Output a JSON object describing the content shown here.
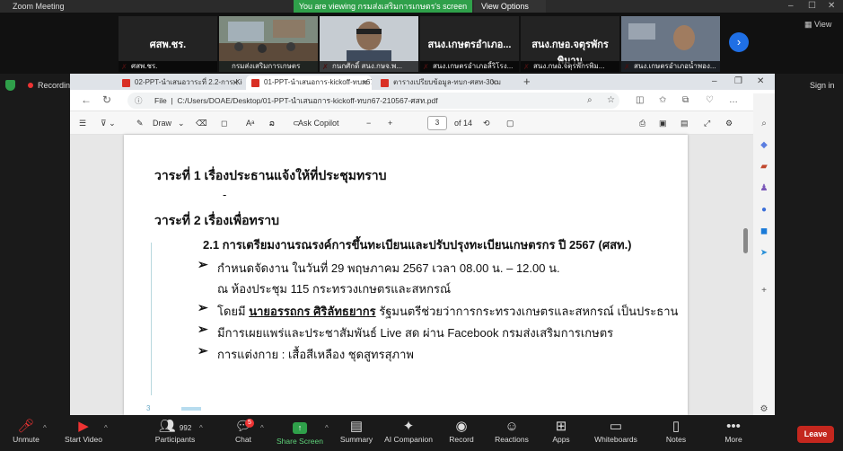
{
  "zoom": {
    "title": "Zoom Meeting",
    "banner": "You are viewing กรมส่งเสริมการเกษตร's screen",
    "view_options": "View Options",
    "view_label": "View",
    "recording": "Recording",
    "sign_in": "Sign in",
    "participants_count": "992",
    "chat_badge": "5",
    "tiles": [
      {
        "big": "ศสพ.ชร.",
        "name": "ศสพ.ชร."
      },
      {
        "big": "",
        "name": "กรมส่งเสริมการเกษตร"
      },
      {
        "big": "",
        "name": "กนกศักดิ์ สนง.กษจ.พ..."
      },
      {
        "big": "สนง.เกษตรอำเภอ...",
        "name": "สนง.เกษตรอำเภอลี้ริโรง..."
      },
      {
        "big": "สนง.กษอ.จตุรพักรพิมาน",
        "name": "สนง.กษอ.จตุรพักรพิม..."
      },
      {
        "big": "",
        "name": "สนง.เกษตรอำเภอน้ำพอง..."
      }
    ],
    "toolbar": [
      {
        "label": "Unmute",
        "icon": "mic-muted-icon"
      },
      {
        "label": "Start Video",
        "icon": "video-off-icon"
      },
      {
        "label": "Participants",
        "icon": "participants-icon"
      },
      {
        "label": "Chat",
        "icon": "chat-icon"
      },
      {
        "label": "Share Screen",
        "icon": "share-screen-icon"
      },
      {
        "label": "Summary",
        "icon": "summary-icon"
      },
      {
        "label": "AI Companion",
        "icon": "ai-companion-icon"
      },
      {
        "label": "Record",
        "icon": "record-icon"
      },
      {
        "label": "Reactions",
        "icon": "reactions-icon"
      },
      {
        "label": "Apps",
        "icon": "apps-icon"
      },
      {
        "label": "Whiteboards",
        "icon": "whiteboards-icon"
      },
      {
        "label": "Notes",
        "icon": "notes-icon"
      },
      {
        "label": "More",
        "icon": "more-icon"
      }
    ],
    "leave": "Leave"
  },
  "browser": {
    "tabs": [
      {
        "title": "02-PPT-นำเสนอวาระที่ 2.2-การ-Kick..."
      },
      {
        "title": "01-PPT-นำเสนอการ-kickoff-ทบก67..."
      },
      {
        "title": "ตารางเปรียบข้อมูล-ทบก-ศสท-30เมย67..."
      }
    ],
    "url_prefix": "File",
    "url": "C:/Users/DOAE/Desktop/01-PPT-นำเสนอการ-kickoff-ทบก67-210567-ศสท.pdf",
    "pdf": {
      "draw": "Draw",
      "ask_copilot": "Ask Copilot",
      "page_current": "3",
      "page_total": "of 14"
    }
  },
  "document": {
    "agenda1": "วาระที่ 1  เรื่องประธานแจ้งให้ที่ประชุมทราบ",
    "dash": "-",
    "agenda2": "วาระที่ 2  เรื่องเพื่อทราบ",
    "section": "2.1 การเตรียมงานรณรงค์การขึ้นทะเบียนและปรับปรุงทะเบียนเกษตรกร ปี 2567 (ศสท.)",
    "b1": "กำหนดจัดงาน ในวันที่ 29 พฤษภาคม 2567 เวลา 08.00 น. – 12.00 น.",
    "b1b": "ณ ห้องประชุม 115 กระทรวงเกษตรและสหกรณ์",
    "b2a": "โดยมี ",
    "b2name": "นายอรรถกร ศิริลัทธยากร",
    "b2b": " รัฐมนตรีช่วยว่าการกระทรวงเกษตรและสหกรณ์ เป็นประธาน",
    "b3": "มีการเผยแพร่และประชาสัมพันธ์ Live สด ผ่าน Facebook กรมส่งเสริมการเกษตร",
    "b4": "การแต่งกาย : เสื้อสีเหลือง ชุดสูทรสุภาพ",
    "page_number": "3"
  }
}
